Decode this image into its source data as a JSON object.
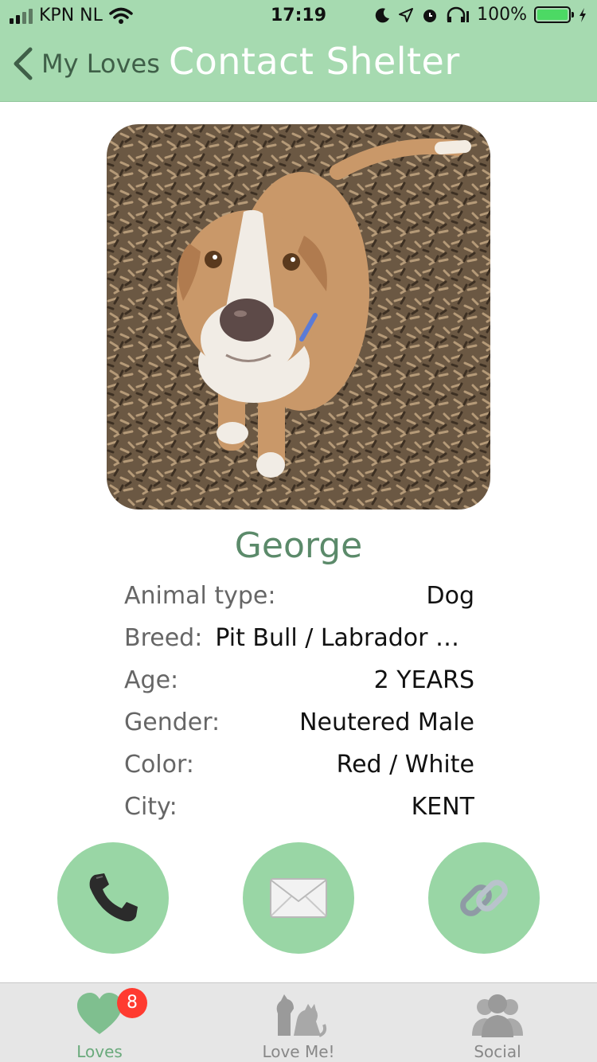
{
  "status": {
    "carrier": "KPN NL",
    "time": "17:19",
    "battery_percent": "100%",
    "battery_level": 1.0
  },
  "nav": {
    "back_label": "My Loves",
    "title": "Contact Shelter"
  },
  "pet": {
    "name": "George",
    "photo_subject": "dog-photo",
    "details": [
      {
        "label": "Animal type:",
        "value": "Dog"
      },
      {
        "label": "Breed:",
        "value": "Pit Bull / Labrador Re…"
      },
      {
        "label": "Age:",
        "value": "2 YEARS"
      },
      {
        "label": "Gender:",
        "value": "Neutered Male"
      },
      {
        "label": "Color:",
        "value": "Red / White"
      },
      {
        "label": "City:",
        "value": "KENT"
      }
    ]
  },
  "actions": [
    {
      "icon": "phone-icon"
    },
    {
      "icon": "envelope-icon"
    },
    {
      "icon": "link-icon"
    }
  ],
  "tabs": [
    {
      "label": "Loves",
      "icon": "heart-icon",
      "badge": "8",
      "active": true
    },
    {
      "label": "Love Me!",
      "icon": "pets-icon",
      "active": false
    },
    {
      "label": "Social",
      "icon": "people-icon",
      "active": false
    }
  ],
  "colors": {
    "header": "#a6dab0",
    "accent": "#99d6a5",
    "name": "#5b8a6a",
    "badge": "#ff3b30"
  }
}
